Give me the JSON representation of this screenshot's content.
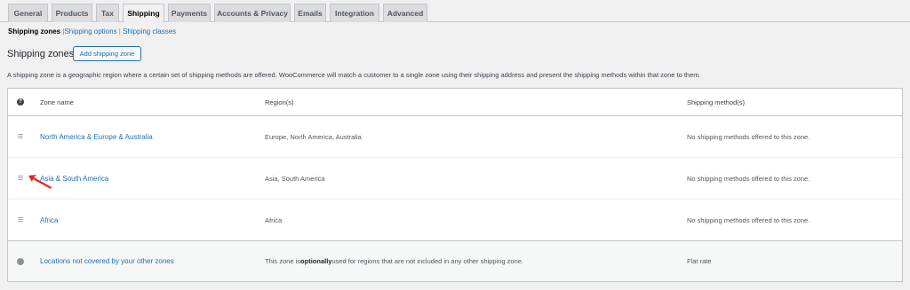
{
  "tabs": [
    {
      "label": "General",
      "active": false
    },
    {
      "label": "Products",
      "active": false
    },
    {
      "label": "Tax",
      "active": false
    },
    {
      "label": "Shipping",
      "active": true
    },
    {
      "label": "Payments",
      "active": false
    },
    {
      "label": "Accounts & Privacy",
      "active": false
    },
    {
      "label": "Emails",
      "active": false
    },
    {
      "label": "Integration",
      "active": false
    },
    {
      "label": "Advanced",
      "active": false
    }
  ],
  "subnav": {
    "current": "Shipping zones",
    "sep1": " |",
    "options": "Shipping options",
    "sep2": " | ",
    "classes": "Shipping classes"
  },
  "heading": "Shipping zones",
  "add_button": "Add shipping zone",
  "description": "A shipping zone is a geographic region where a certain set of shipping methods are offered. WooCommerce will match a customer to a single zone using their shipping address and present the shipping methods within that zone to them.",
  "table": {
    "headers": {
      "name": "Zone name",
      "region": "Region(s)",
      "method": "Shipping method(s)"
    },
    "rows": [
      {
        "name": "North America & Europe & Australia",
        "region": "Europe, North America, Australia",
        "method": "No shipping methods offered to this zone."
      },
      {
        "name": "Asia & South America",
        "region": "Asia, South America",
        "method": "No shipping methods offered to this zone."
      },
      {
        "name": "Africa",
        "region": "Africa",
        "method": "No shipping methods offered to this zone."
      }
    ],
    "other": {
      "name": "Locations not covered by your other zones",
      "region_pre": "This zone is ",
      "region_bold": "optionally",
      "region_post": " used for regions that are not included in any other shipping zone.",
      "method": "Flat rate"
    }
  },
  "colors": {
    "accent": "#2271b1",
    "annotation": "#e8231a"
  },
  "icons": {
    "help": "help-icon",
    "handle": "drag-handle-icon",
    "globe": "globe-icon",
    "annotation": "red-arrow"
  }
}
